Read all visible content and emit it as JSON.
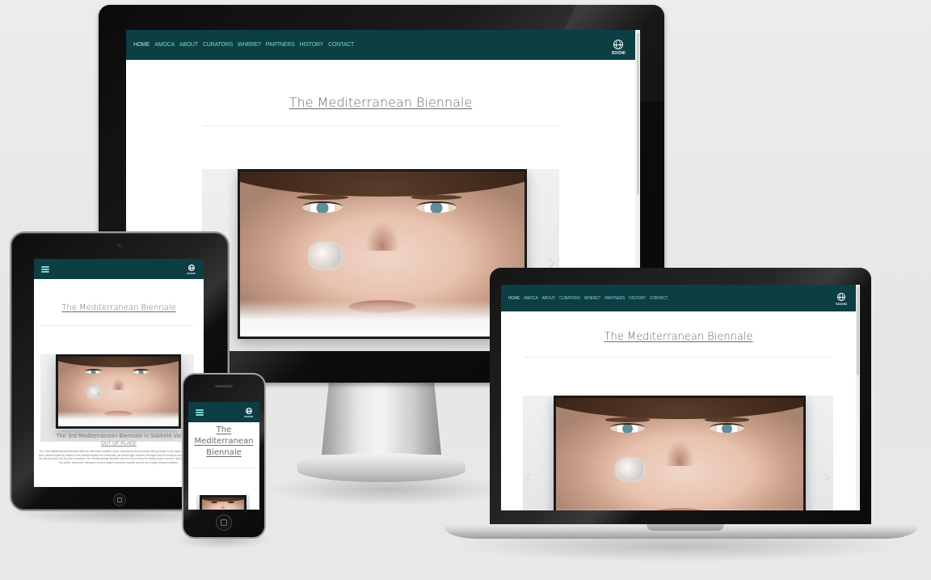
{
  "site": {
    "title": "The Mediterranean Biennale",
    "logo_text": "SOONI",
    "nav": [
      "HOME",
      "AMOCA",
      "ABOUT",
      "CURATORS",
      "WHERE?",
      "PARTNERS",
      "HISTORY",
      "CONTACT"
    ],
    "next_arrow": "›",
    "prev_arrow": "‹"
  },
  "tablet": {
    "title": "The Mediterranean Biennale",
    "subheading": "The 3rd Mediterranean Biennale in Sakhnin Valley",
    "link": "OUT OF PLACE",
    "body": "The Third Mediterranean Biennale offers an alternative platform which emphasizes the processes being created in the region and enhances their cultural impact by means of art, directed toward the community: art that bridges cultures, emerges from the museum and integrates into the city and turns the city into a museum. The Mediterranean Biennale will serve as a venue for raising issues such as: How to restore art to the public, what is the relevance of art in today's consumer society, and art as a bridge between cultures."
  },
  "phone": {
    "title": "The Mediterranean Biennale"
  },
  "icons": {
    "menu": "hamburger-menu-icon",
    "logo": "globe-icon",
    "next": "chevron-right-icon",
    "prev": "chevron-left-icon"
  },
  "colors": {
    "nav_bg": "#0c3e44",
    "nav_link": "#7fd3cf",
    "title": "#6b6b6b"
  }
}
